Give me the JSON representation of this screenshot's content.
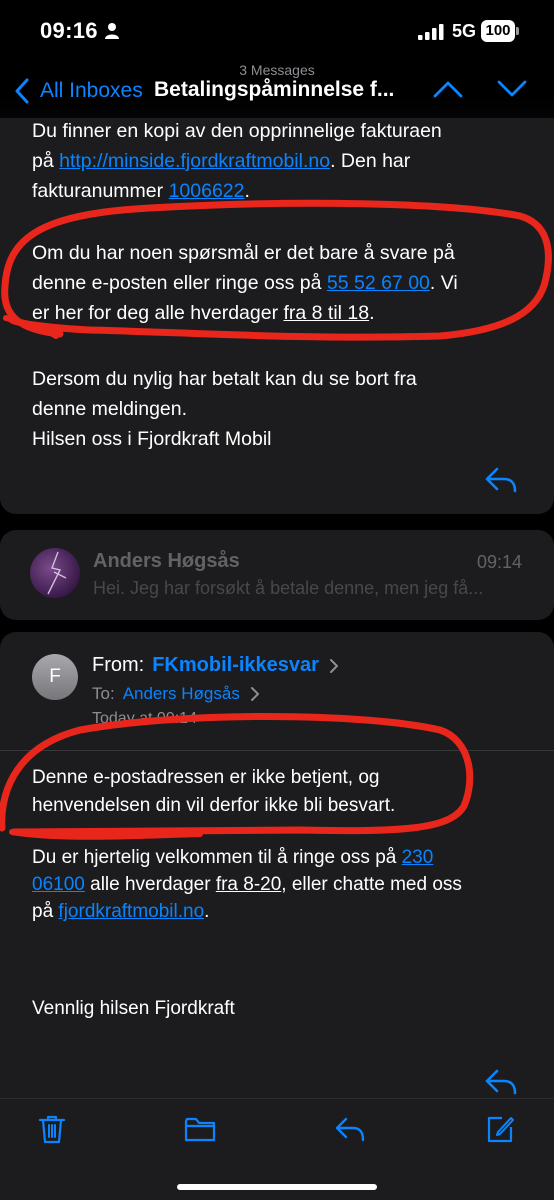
{
  "status_bar": {
    "time": "09:16",
    "network": "5G",
    "battery": "100",
    "icons": [
      "person-icon",
      "signal-icon",
      "battery-icon"
    ]
  },
  "nav": {
    "message_count": "3 Messages",
    "back_label": "All Inboxes",
    "title": "Betalingspåminnelse f...",
    "icons": [
      "chevron-left-icon",
      "chevron-up-icon",
      "chevron-down-icon"
    ]
  },
  "message1": {
    "para1": {
      "line1": "Du finner en kopi av den opprinnelige fakturaen",
      "line2_pre": "på ",
      "line2_link": "http://minside.fjordkraftmobil.no",
      "line2_post": ". Den har",
      "line3_pre": "fakturanummer ",
      "line3_link": "1006622",
      "line3_post": "."
    },
    "para2": {
      "line1": "Om du har noen spørsmål er det bare å svare på",
      "line2_pre": "denne e-posten eller ringe oss på ",
      "line2_link": "55 52 67 00",
      "line2_post": ". Vi",
      "line3_pre": "er her for deg alle hverdager ",
      "line3_underline": "fra 8 til 18",
      "line3_post": "."
    },
    "para3": {
      "line1": "Dersom du nylig har betalt kan du se bort fra",
      "line2": "denne meldingen.",
      "line3": "Hilsen oss i Fjordkraft Mobil"
    }
  },
  "message2": {
    "sender": "Anders Høgsås",
    "time": "09:14",
    "preview": "Hei. Jeg har forsøkt å betale denne, men jeg få..."
  },
  "message3": {
    "avatar_initial": "F",
    "from_label": "From:",
    "from_value": "FKmobil-ikkesvar",
    "to_label": "To:",
    "to_value": "Anders Høgsås",
    "date": "Today at 09:14",
    "para1": {
      "line1": "Denne e-postadressen er ikke betjent, og",
      "line2": "henvendelsen din vil derfor ikke bli besvart."
    },
    "para2": {
      "line1_pre": "Du er hjertelig velkommen til å ringe oss på ",
      "line1_link": "230",
      "line2_link": "06100",
      "line2_mid": " alle hverdager ",
      "line2_underline": "fra 8-20",
      "line2_post": ", eller chatte med oss",
      "line3_pre": "på ",
      "line3_link": "fjordkraftmobil.no",
      "line3_post": "."
    },
    "signature": "Vennlig hilsen Fjordkraft"
  },
  "toolbar": {
    "icons": [
      "trash-icon",
      "folder-icon",
      "reply-icon",
      "compose-icon"
    ]
  },
  "colors": {
    "accent": "#0a84ff",
    "annotation": "#e8261c",
    "card": "#1c1c1e",
    "background": "#000000"
  }
}
